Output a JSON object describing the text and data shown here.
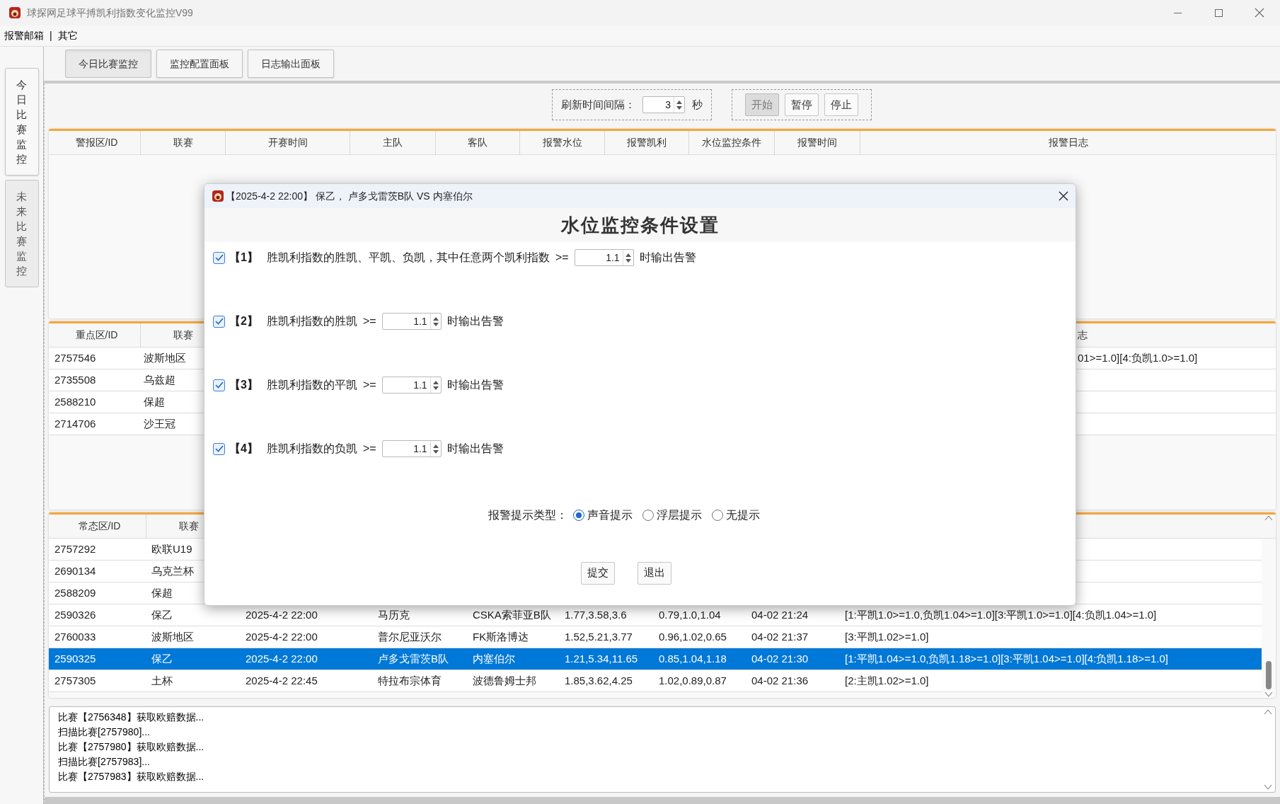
{
  "window": {
    "title": "球探网足球平搏凯利指数变化监控V99"
  },
  "menu": {
    "items": [
      "报警邮箱",
      "其它"
    ],
    "separator": "|"
  },
  "side_tabs": [
    {
      "label": "今日比赛监控",
      "selected": true
    },
    {
      "label": "未来比赛监控",
      "selected": false
    }
  ],
  "tabs": [
    {
      "label": "今日比赛监控",
      "selected": true
    },
    {
      "label": "监控配置面板",
      "selected": false
    },
    {
      "label": "日志输出面板",
      "selected": false
    }
  ],
  "toolbar": {
    "refresh_label": "刷新时间间隔：",
    "interval": "3",
    "unit": "秒",
    "buttons": [
      {
        "label": "开始",
        "disabled": true
      },
      {
        "label": "暂停",
        "disabled": false
      },
      {
        "label": "停止",
        "disabled": false
      }
    ]
  },
  "alert_table": {
    "columns": [
      "警报区/ID",
      "联赛",
      "开赛时间",
      "主队",
      "客队",
      "报警水位",
      "报警凯利",
      "水位监控条件",
      "报警时间",
      "报警日志"
    ]
  },
  "key_table": {
    "columns": [
      "重点区/ID",
      "联赛"
    ],
    "log_column_fragment": "志",
    "rows": [
      {
        "id": "2757546",
        "league": "波斯地区",
        "log": "01>=1.0][4:负凯1.0>=1.0]"
      },
      {
        "id": "2735508",
        "league": "乌兹超"
      },
      {
        "id": "2588210",
        "league": "保超"
      },
      {
        "id": "2714706",
        "league": "沙王冠"
      }
    ]
  },
  "normal_table": {
    "columns": [
      "常态区/ID",
      "联赛"
    ],
    "rows": [
      {
        "id": "2757292",
        "league": "欧联U19",
        "selected": false
      },
      {
        "id": "2690134",
        "league": "乌克兰杯",
        "selected": false
      },
      {
        "id": "2588209",
        "league": "保超",
        "selected": false
      },
      {
        "id": "2590326",
        "league": "保乙",
        "start_time": "2025-4-2 22:00",
        "home": "马历克",
        "away": "CSKA索菲亚B队",
        "odds": "1.77,3.58,3.6",
        "kelly": "0.79,1.0,1.04",
        "alert_time": "04-02 21:24",
        "log": "[1:平凯1.0>=1.0,负凯1.04>=1.0][3:平凯1.0>=1.0][4:负凯1.04>=1.0]",
        "selected": false
      },
      {
        "id": "2760033",
        "league": "波斯地区",
        "start_time": "2025-4-2 22:00",
        "home": "普尔尼亚沃尔",
        "away": "FK斯洛博达",
        "odds": "1.52,5.21,3.77",
        "kelly": "0.96,1.02,0.65",
        "alert_time": "04-02 21:37",
        "log": "[3:平凯1.02>=1.0]",
        "selected": false
      },
      {
        "id": "2590325",
        "league": "保乙",
        "start_time": "2025-4-2 22:00",
        "home": "卢多戈雷茨B队",
        "away": "内塞伯尔",
        "odds": "1.21,5.34,11.65",
        "kelly": "0.85,1.04,1.18",
        "alert_time": "04-02 21:30",
        "log": "[1:平凯1.04>=1.0,负凯1.18>=1.0][3:平凯1.04>=1.0][4:负凯1.18>=1.0]",
        "selected": true
      },
      {
        "id": "2757305",
        "league": "土杯",
        "start_time": "2025-4-2 22:45",
        "home": "特拉布宗体育",
        "away": "波德鲁姆士邦",
        "odds": "1.85,3.62,4.25",
        "kelly": "1.02,0.89,0.87",
        "alert_time": "04-02 21:36",
        "log": "[2:主凯1.02>=1.0]",
        "selected": false
      }
    ]
  },
  "log_lines": [
    "比赛【2756348】获取欧赔数据...",
    "扫描比赛[2757980]...",
    "比赛【2757980】获取欧赔数据...",
    "扫描比赛[2757983]...",
    "比赛【2757983】获取欧赔数据..."
  ],
  "dialog": {
    "title": "【2025-4-2 22:00】 保乙， 卢多戈雷茨B队 VS 内塞伯尔",
    "heading": "水位监控条件设置",
    "conditions": [
      {
        "index": "【1】",
        "text": "胜凯利指数的胜凯、平凯、负凯，其中任意两个凯利指数",
        "op": ">=",
        "value": "1.1",
        "suffix": "时输出告警",
        "checked": true
      },
      {
        "index": "【2】",
        "text": "胜凯利指数的胜凯",
        "op": ">=",
        "value": "1.1",
        "suffix": "时输出告警",
        "checked": true
      },
      {
        "index": "【3】",
        "text": "胜凯利指数的平凯",
        "op": ">=",
        "value": "1.1",
        "suffix": "时输出告警",
        "checked": true
      },
      {
        "index": "【4】",
        "text": "胜凯利指数的负凯",
        "op": ">=",
        "value": "1.1",
        "suffix": "时输出告警",
        "checked": true
      }
    ],
    "alert_type": {
      "label": "报警提示类型：",
      "options": [
        {
          "label": "声音提示",
          "selected": true
        },
        {
          "label": "浮层提示",
          "selected": false
        },
        {
          "label": "无提示",
          "selected": false
        }
      ]
    },
    "buttons": [
      "提交",
      "退出"
    ]
  }
}
